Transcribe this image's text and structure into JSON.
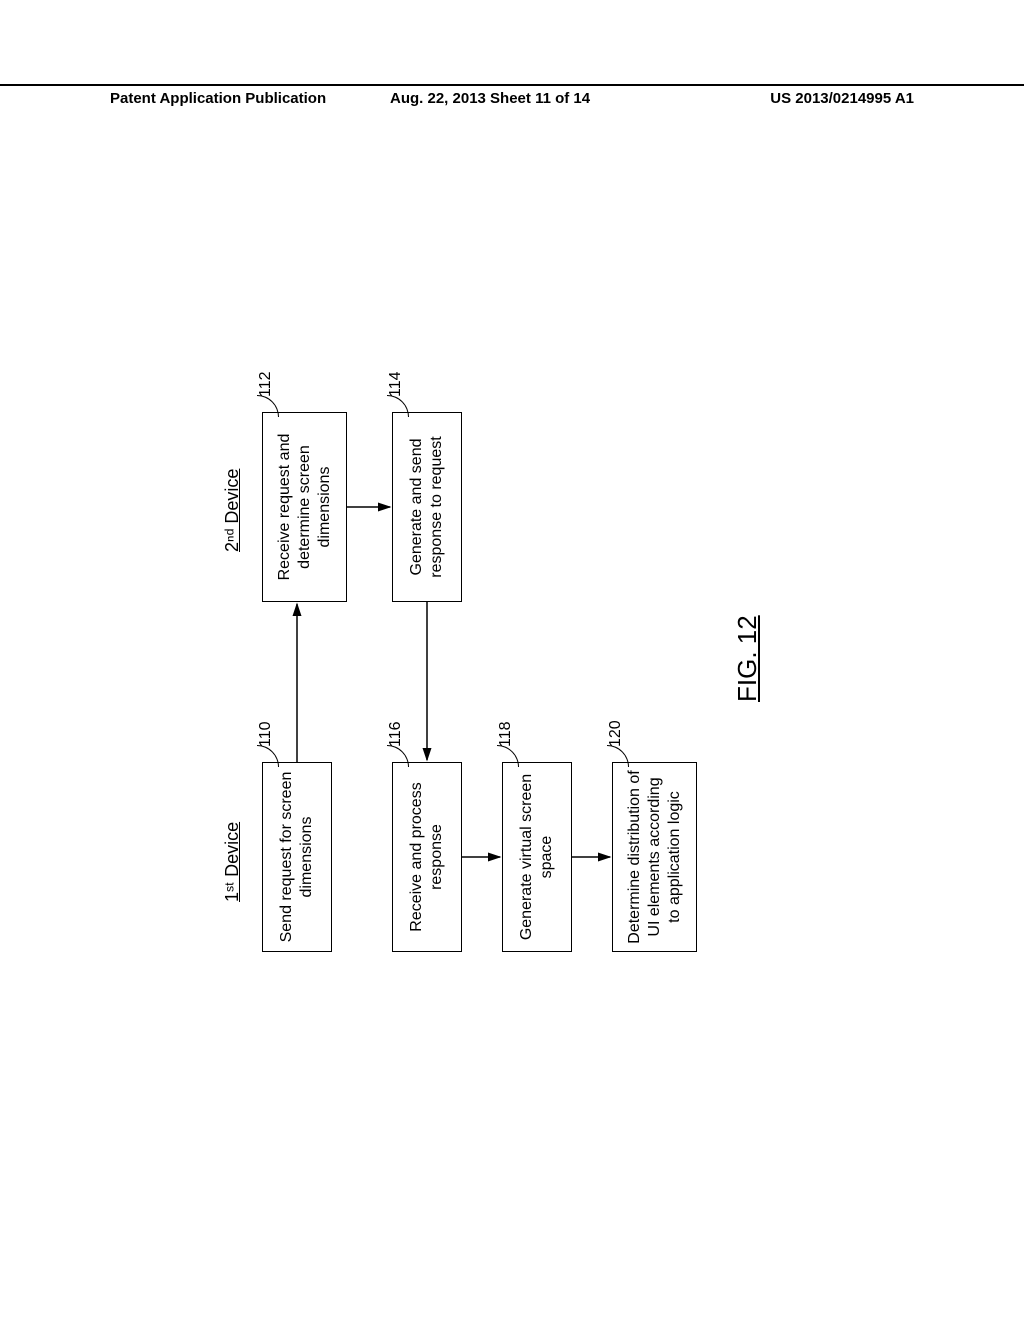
{
  "header": {
    "left": "Patent Application Publication",
    "mid": "Aug. 22, 2013  Sheet 11 of 14",
    "right": "US 2013/0214995 A1"
  },
  "diagram": {
    "col1_label": "1ˢᵗ Device",
    "col2_label": "2ⁿᵈ Device",
    "figure_label": "FIG. 12",
    "boxes": {
      "b110": {
        "text": "Send request for screen dimensions",
        "ref": "110"
      },
      "b112": {
        "text": "Receive request and determine screen dimensions",
        "ref": "112"
      },
      "b114": {
        "text": "Generate and send response to request",
        "ref": "114"
      },
      "b116": {
        "text": "Receive and process response",
        "ref": "116"
      },
      "b118": {
        "text": "Generate virtual screen space",
        "ref": "118"
      },
      "b120": {
        "text": "Determine distribution of UI elements according to application logic",
        "ref": "120"
      }
    }
  }
}
